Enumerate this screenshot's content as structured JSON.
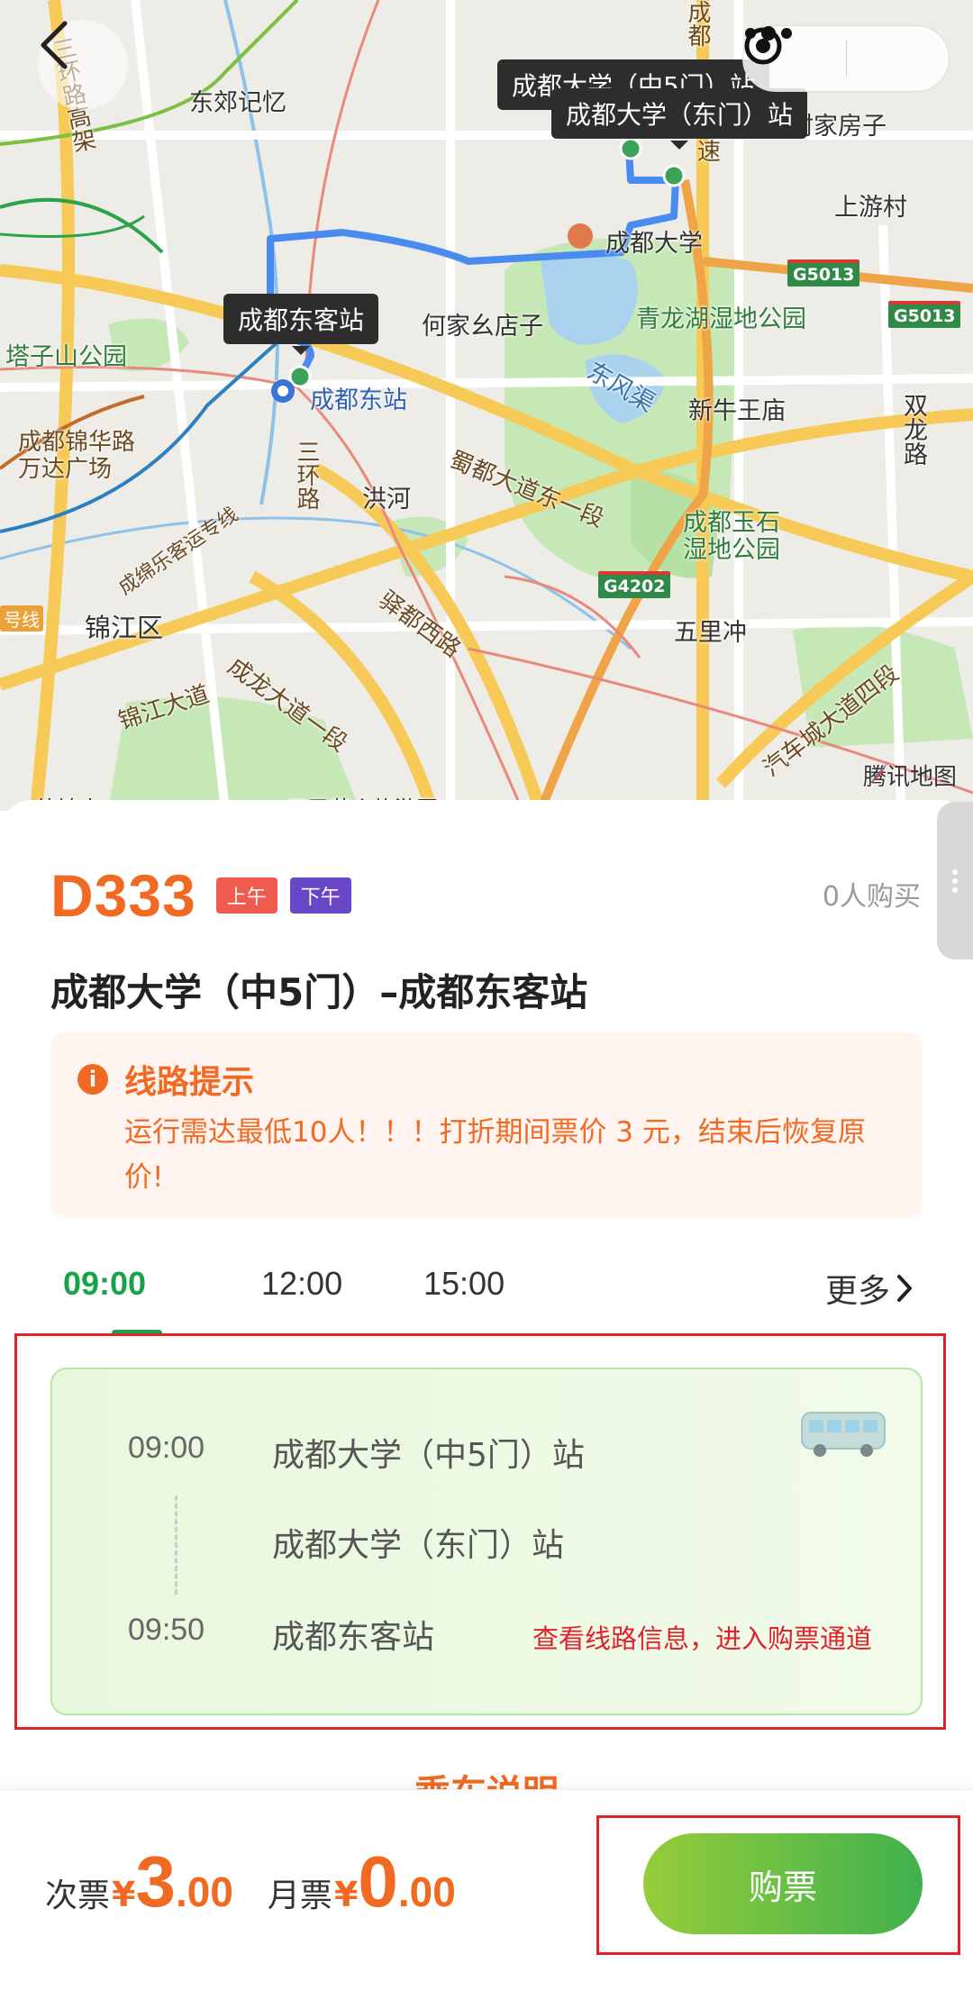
{
  "map": {
    "callouts": {
      "top_back": "成都大学（中5门）站",
      "top_front": "成都大学（东门）站",
      "left": "成都东客站"
    },
    "labels": {
      "dongjiao": "东郊记忆",
      "sanhuan_gaojia": "三环路高架",
      "chengdu_n": "成都",
      "jiajiafangzi": "村家房子",
      "shangyoucun": "上游村",
      "cdu": "成都大学",
      "hejiayaodianzi": "何家幺店子",
      "qinglonghu": "青龙湖湿地公园",
      "tazishan": "塔子山公园",
      "chengdudongzhan": "成都东站",
      "dongfengqu": "东风渠",
      "xinniuwangmiao": "新牛王庙",
      "shuanglonglu": "双龙路",
      "jinhualu": "成都锦华路",
      "wandaguangchang": "万达广场",
      "shududadao": "蜀都大道东一段",
      "sanhuanlu": "三环路",
      "honghe": "洪河",
      "yushi_park_1": "成都玉石",
      "yushi_park_2": "湿地公园",
      "chengmian": "成绵乐客运专线",
      "yiduxilu": "驿都西路",
      "wulichong": "五里冲",
      "jinjiangqu": "锦江区",
      "qichecheng": "汽车城大道四段",
      "chenglong": "成龙大道一段",
      "jinjiangdadao": "锦江大道",
      "xian": "号线",
      "su": "速",
      "zhujinshan": "竹锦山",
      "sansheng": "三圣花乡旅游区"
    },
    "highways": [
      "G5013",
      "G5013",
      "G4202"
    ],
    "provider": "腾讯地图"
  },
  "route": {
    "code": "D333",
    "tags": [
      "上午",
      "下午"
    ],
    "buyers": "0人购买",
    "title": "成都大学（中5门）–成都东客站"
  },
  "notice": {
    "title": "线路提示",
    "text": "运行需达最低10人！！！打折期间票价 3 元，结束后恢复原价!"
  },
  "times": {
    "tabs": [
      "09:00",
      "12:00",
      "15:00"
    ],
    "active": "09:00",
    "more": "更多"
  },
  "schedule": {
    "stops": [
      {
        "time": "09:00",
        "name": "成都大学（中5门）站"
      },
      {
        "time": "",
        "name": "成都大学（东门）站"
      },
      {
        "time": "09:50",
        "name": "成都东客站"
      }
    ],
    "hint": "查看线路信息，进入购票通道"
  },
  "peek_title": "乘车说明",
  "bottom": {
    "single_label": "次票",
    "single_currency": "¥",
    "single_int": "3",
    "single_dec": ".00",
    "monthly_label": "月票",
    "monthly_currency": "¥",
    "monthly_int": "0",
    "monthly_dec": ".00",
    "buy_label": "购票"
  },
  "colors": {
    "accent_orange": "#f06a24",
    "accent_green": "#18a34a",
    "annotation_red": "#e0222a",
    "route_blue": "#4a8bef"
  }
}
